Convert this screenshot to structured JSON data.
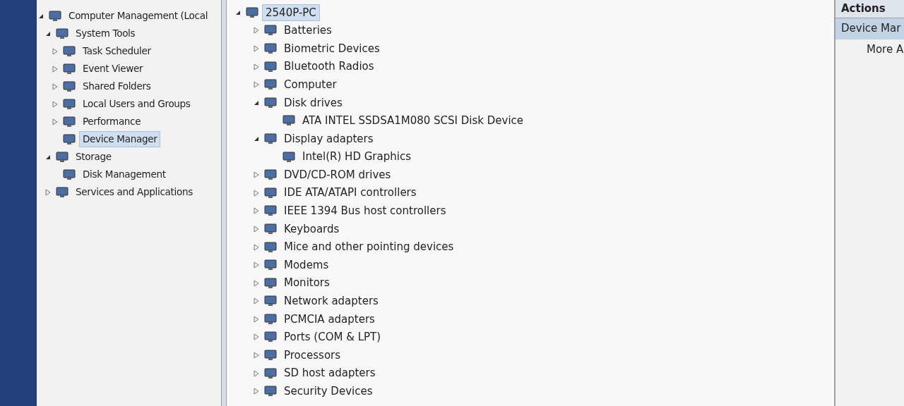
{
  "console_tree": [
    {
      "label": "Computer Management (Local",
      "expanded": true,
      "selected": false,
      "children": [
        {
          "label": "System Tools",
          "expanded": true,
          "selected": false,
          "children": [
            {
              "label": "Task Scheduler",
              "expanded": false,
              "selected": false
            },
            {
              "label": "Event Viewer",
              "expanded": false,
              "selected": false
            },
            {
              "label": "Shared Folders",
              "expanded": false,
              "selected": false
            },
            {
              "label": "Local Users and Groups",
              "expanded": false,
              "selected": false
            },
            {
              "label": "Performance",
              "expanded": false,
              "selected": false
            },
            {
              "label": "Device Manager",
              "selected": true
            }
          ]
        },
        {
          "label": "Storage",
          "expanded": true,
          "selected": false,
          "children": [
            {
              "label": "Disk Management",
              "selected": false
            }
          ]
        },
        {
          "label": "Services and Applications",
          "expanded": false,
          "selected": false
        }
      ]
    }
  ],
  "device_tree": [
    {
      "label": "2540P-PC",
      "expanded": true,
      "selected": true,
      "children": [
        {
          "label": "Batteries",
          "expanded": false,
          "selected": false
        },
        {
          "label": "Biometric Devices",
          "expanded": false,
          "selected": false
        },
        {
          "label": "Bluetooth Radios",
          "expanded": false,
          "selected": false
        },
        {
          "label": "Computer",
          "expanded": false,
          "selected": false
        },
        {
          "label": "Disk drives",
          "expanded": true,
          "selected": false,
          "children": [
            {
              "label": "ATA INTEL SSDSA1M080 SCSI Disk Device",
              "selected": false
            }
          ]
        },
        {
          "label": "Display adapters",
          "expanded": true,
          "selected": false,
          "children": [
            {
              "label": "Intel(R) HD Graphics",
              "selected": false
            }
          ]
        },
        {
          "label": "DVD/CD-ROM drives",
          "expanded": false,
          "selected": false
        },
        {
          "label": "IDE ATA/ATAPI controllers",
          "expanded": false,
          "selected": false
        },
        {
          "label": "IEEE 1394 Bus host controllers",
          "expanded": false,
          "selected": false
        },
        {
          "label": "Keyboards",
          "expanded": false,
          "selected": false
        },
        {
          "label": "Mice and other pointing devices",
          "expanded": false,
          "selected": false
        },
        {
          "label": "Modems",
          "expanded": false,
          "selected": false
        },
        {
          "label": "Monitors",
          "expanded": false,
          "selected": false
        },
        {
          "label": "Network adapters",
          "expanded": false,
          "selected": false
        },
        {
          "label": "PCMCIA adapters",
          "expanded": false,
          "selected": false
        },
        {
          "label": "Ports (COM & LPT)",
          "expanded": false,
          "selected": false
        },
        {
          "label": "Processors",
          "expanded": false,
          "selected": false
        },
        {
          "label": "SD host adapters",
          "expanded": false,
          "selected": false
        },
        {
          "label": "Security Devices",
          "expanded": false,
          "selected": false
        }
      ]
    }
  ],
  "actions": {
    "title": "Actions",
    "items": [
      {
        "label": "Device Mar",
        "selected": true
      },
      {
        "label": "More A",
        "selected": false
      }
    ]
  }
}
